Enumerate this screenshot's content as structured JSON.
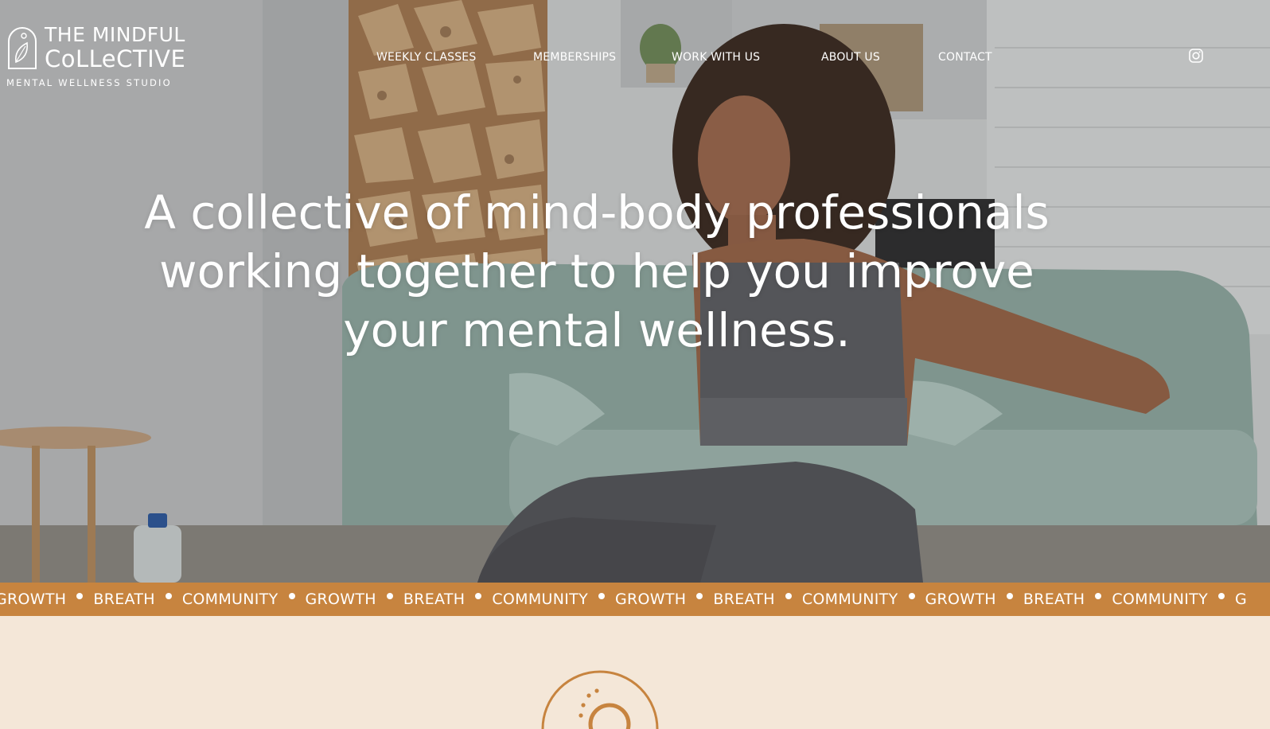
{
  "brand": {
    "line1": "THE MINDFUL",
    "line2": "CoLLeCTIVE",
    "line3": "MENTAL WELLNESS STUDIO",
    "logo_icon": "leaf-arch-icon"
  },
  "nav": {
    "items": [
      {
        "label": "WEEKLY CLASSES"
      },
      {
        "label": "MEMBERSHIPS"
      },
      {
        "label": "WORK WITH US"
      },
      {
        "label": "ABOUT US"
      },
      {
        "label": "CONTACT"
      }
    ],
    "social_icon": "instagram-icon"
  },
  "hero": {
    "headline": "A collective of mind-body professionals working together to help you improve your mental wellness."
  },
  "marquee": {
    "words": [
      "GROWTH",
      "BREATH",
      "COMMUNITY",
      "GROWTH",
      "BREATH",
      "COMMUNITY",
      "GROWTH",
      "BREATH",
      "COMMUNITY",
      "GROWTH",
      "BREATH",
      "COMMUNITY",
      "G"
    ]
  },
  "lower_section": {
    "emblem_icon": "sun-arch-emblem-icon"
  },
  "colors": {
    "accent": "#c7843f",
    "cream": "#f4e7d8",
    "white": "#ffffff"
  }
}
